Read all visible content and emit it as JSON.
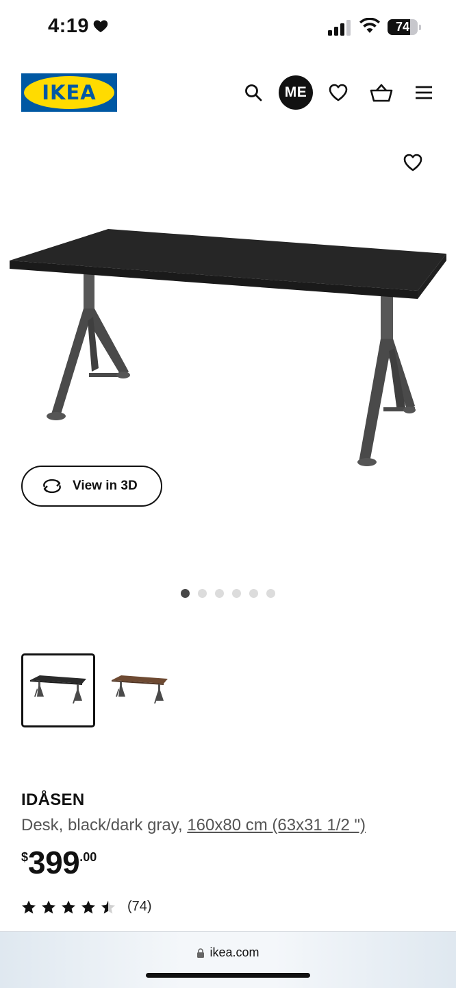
{
  "status_bar": {
    "time": "4:19",
    "battery": "74",
    "battery_level": 0.74
  },
  "header": {
    "logo_text": "IKEA",
    "avatar_initials": "ME",
    "icons": [
      "search-icon",
      "wishlist-icon",
      "cart-icon",
      "menu-icon"
    ]
  },
  "gallery": {
    "view_3d_label": "View in 3D",
    "dot_count": 6,
    "active_dot": 0
  },
  "thumbnails": [
    {
      "variant": "black/dark gray",
      "selected": true
    },
    {
      "variant": "brown",
      "selected": false
    }
  ],
  "product": {
    "name": "IDÅSEN",
    "description": "Desk, black/dark gray,",
    "dimensions": "160x80 cm (63x31 1/2 \")",
    "price_currency": "$",
    "price_integer": "399",
    "price_decimal": ".00",
    "rating": 4.5,
    "review_count": "(74)"
  },
  "browser": {
    "url": "ikea.com"
  },
  "colors": {
    "logo_blue": "#0058a3",
    "logo_yellow": "#ffdb00",
    "text": "#111111",
    "muted": "#555555"
  }
}
